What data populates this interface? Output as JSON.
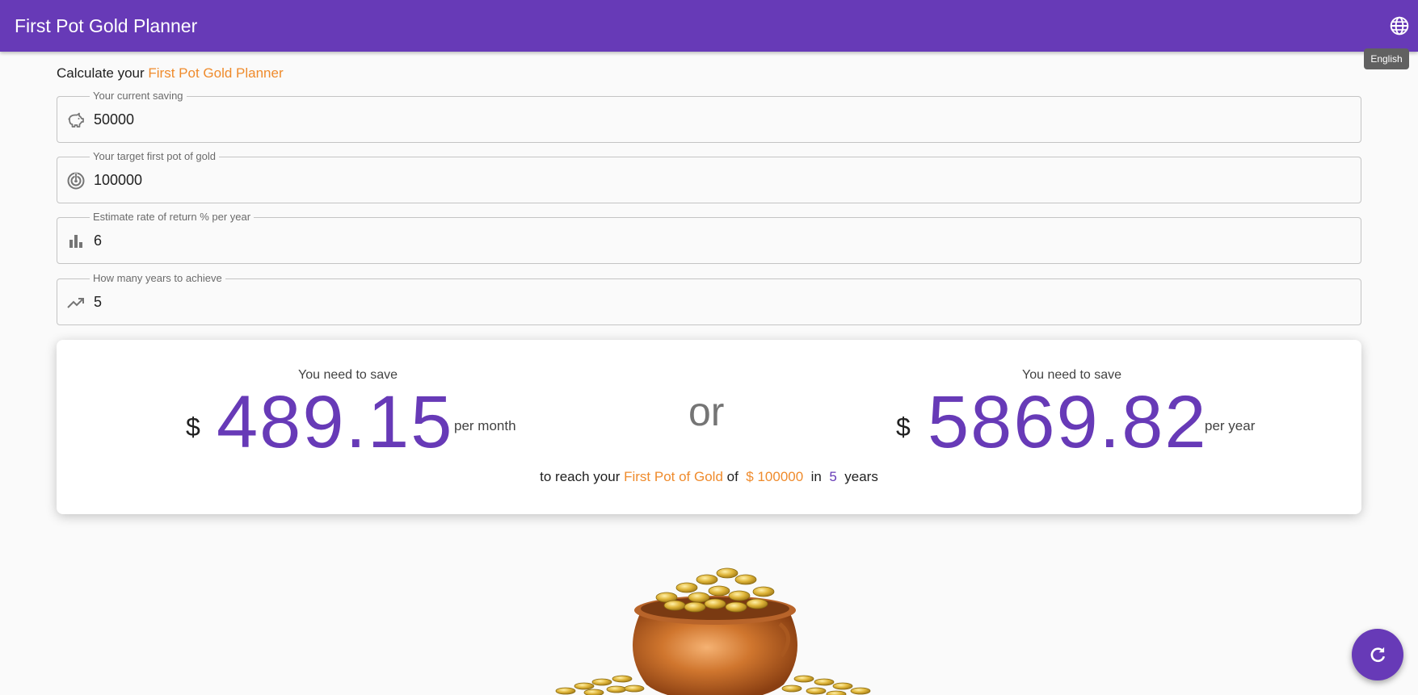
{
  "appbar": {
    "title": "First Pot Gold Planner",
    "language_icon": "globe-icon",
    "language_tooltip": "English"
  },
  "heading": {
    "prefix": "Calculate your ",
    "highlight": "First Pot Gold Planner"
  },
  "form": {
    "fields": [
      {
        "label": "Your current saving",
        "value": "50000",
        "icon": "piggy-bank-icon"
      },
      {
        "label": "Your target first pot of gold",
        "value": "100000",
        "icon": "target-icon"
      },
      {
        "label": "Estimate rate of return % per year",
        "value": "6",
        "icon": "bar-chart-icon"
      },
      {
        "label": "How many years to achieve",
        "value": "5",
        "icon": "trending-up-icon"
      }
    ]
  },
  "result": {
    "monthly": {
      "label": "You need to save",
      "currency": "$",
      "amount": "489.15",
      "unit": "per month"
    },
    "or": "or",
    "yearly": {
      "label": "You need to save",
      "currency": "$",
      "amount": "5869.82",
      "unit": "per year"
    },
    "summary": {
      "part1": "to reach your ",
      "highlight": "First Pot of Gold",
      "part2": " of ",
      "target": "$ 100000",
      "part3": " in ",
      "years": "5",
      "part4": " years"
    }
  },
  "image": {
    "icon": "pot-of-gold-image"
  },
  "fab": {
    "icon": "refresh-icon"
  },
  "colors": {
    "primary": "#673ab7",
    "accent": "#ef8b2c",
    "background": "#fafafa"
  }
}
